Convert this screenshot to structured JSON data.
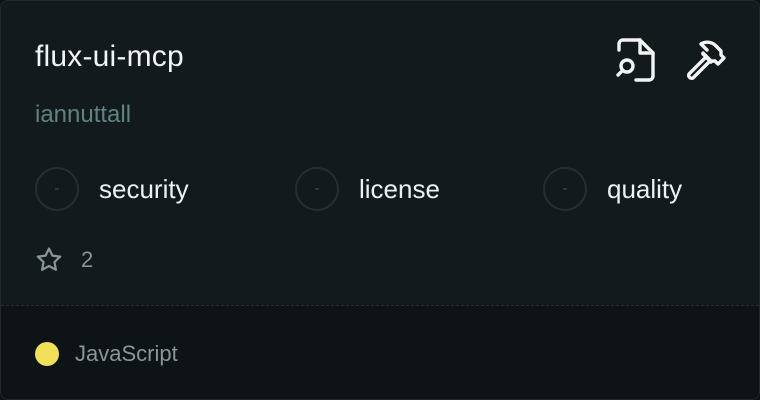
{
  "repo": {
    "name": "flux-ui-mcp",
    "owner": "iannuttall"
  },
  "actions": [
    {
      "icon": "document-search-icon"
    },
    {
      "icon": "hammer-icon"
    }
  ],
  "badges": [
    {
      "value": "-",
      "label": "security"
    },
    {
      "value": "-",
      "label": "license"
    },
    {
      "value": "-",
      "label": "quality"
    }
  ],
  "stars": {
    "icon": "star-icon",
    "count": "2"
  },
  "language": {
    "name": "JavaScript",
    "color": "#f1e05a"
  }
}
